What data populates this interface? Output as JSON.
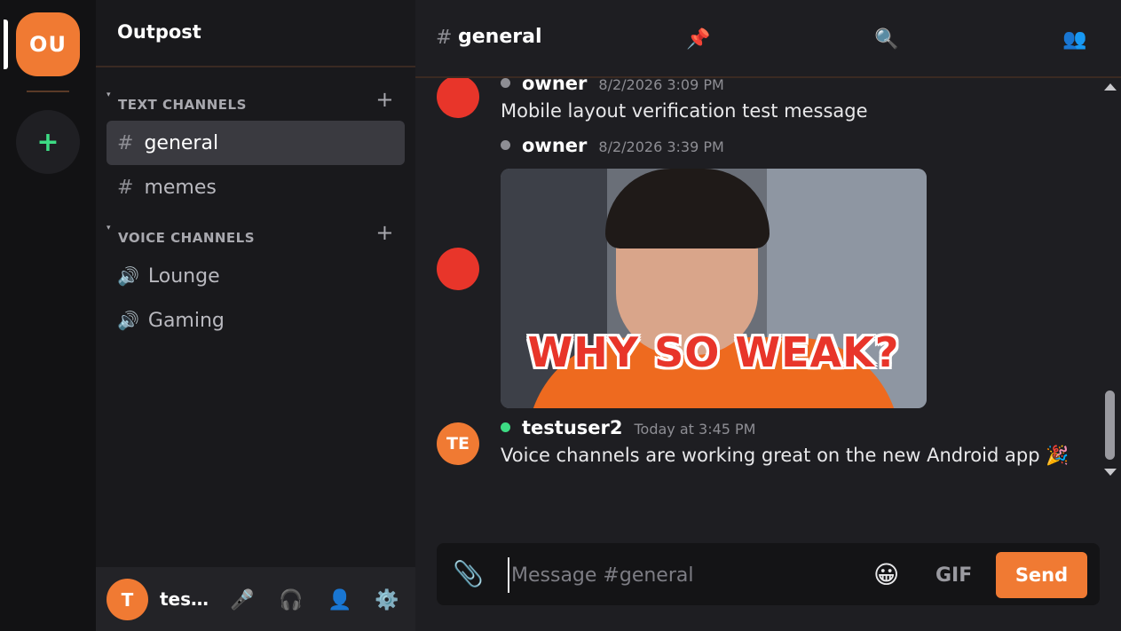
{
  "rail": {
    "server_initials": "OU",
    "add_server": "+"
  },
  "server": {
    "name": "Outpost"
  },
  "categories": {
    "text": "TEXT CHANNELS",
    "voice": "VOICE CHANNELS",
    "add": "+",
    "caret": "▾"
  },
  "channels": {
    "hash": "#",
    "speaker": "🔊",
    "text": [
      {
        "name": "general",
        "active": true
      },
      {
        "name": "memes",
        "active": false
      }
    ],
    "voice": [
      {
        "name": "Lounge"
      },
      {
        "name": "Gaming"
      }
    ]
  },
  "user": {
    "initial": "T",
    "name": "test..."
  },
  "user_controls": {
    "mic": "🎤",
    "headphones": "🎧",
    "profile": "👤",
    "settings": "⚙️"
  },
  "topbar": {
    "hash": "#",
    "channel": "general",
    "pin": "📌",
    "search": "🔍",
    "members": "👥"
  },
  "messages": [
    {
      "author": "owner",
      "timestamp": "8/2/2026 3:09 PM",
      "text": "Mobile layout verification test message",
      "status": "offline"
    },
    {
      "author": "owner",
      "timestamp": "8/2/2026 3:39 PM",
      "gif_caption": "WHY SO WEAK?",
      "status": "offline"
    },
    {
      "author": "testuser2",
      "initials": "TE",
      "timestamp": "Today at 3:45 PM",
      "text": "Voice channels are working great on the new Android app 🎉",
      "status": "online"
    }
  ],
  "composer": {
    "attach": "📎",
    "placeholder": "Message #general",
    "emoji": "😀",
    "gif": "GIF",
    "send": "Send"
  },
  "colors": {
    "accent": "#f07a33",
    "online": "#3ddc84",
    "offline": "#8e8e94",
    "avatar_red": "#e8352a"
  }
}
